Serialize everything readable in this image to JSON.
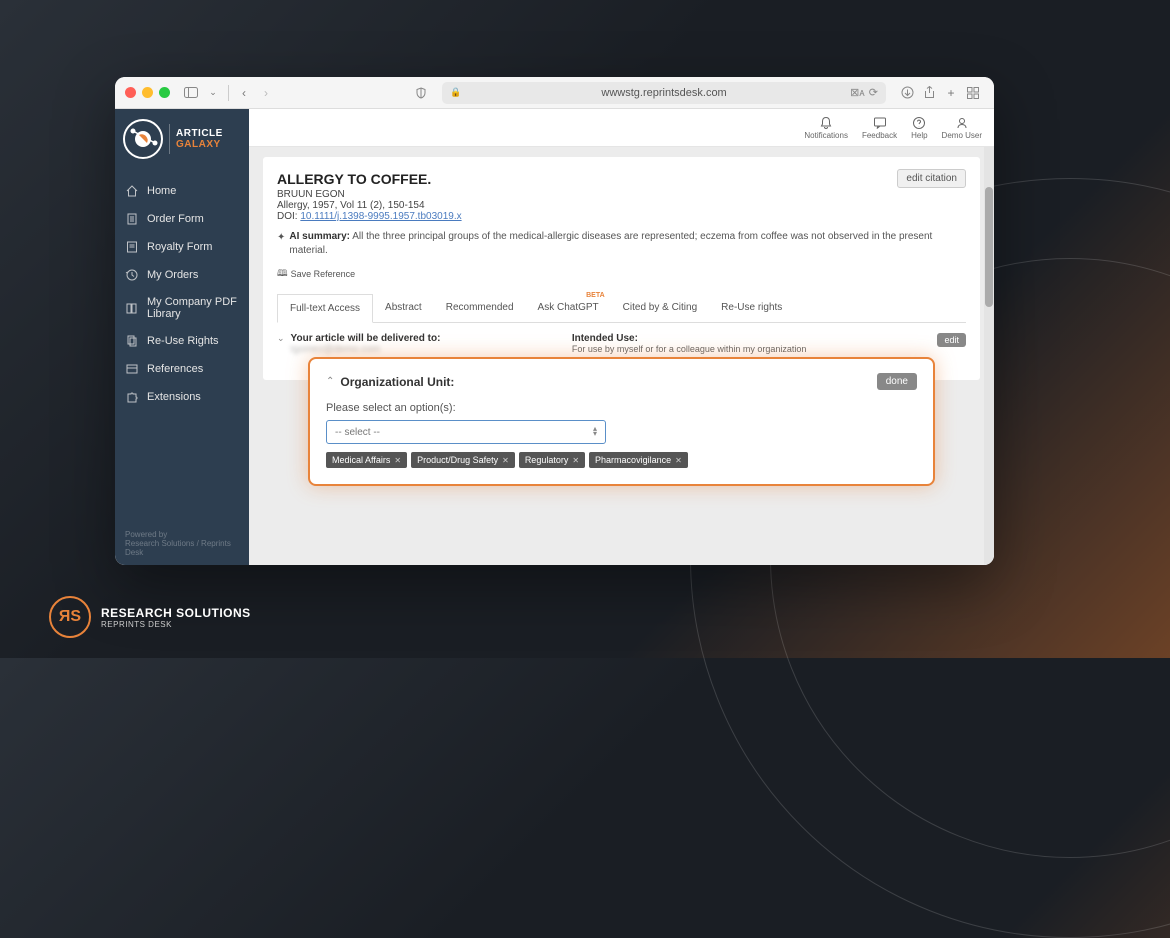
{
  "browser": {
    "url": "wwwstg.reprintsdesk.com"
  },
  "brand": {
    "name": "ARTICLE",
    "sub": "GALAXY"
  },
  "sidebar": {
    "items": [
      {
        "label": "Home",
        "icon": "home"
      },
      {
        "label": "Order Form",
        "icon": "file"
      },
      {
        "label": "Royalty Form",
        "icon": "doc"
      },
      {
        "label": "My Orders",
        "icon": "clock"
      },
      {
        "label": "My Company PDF Library",
        "icon": "library"
      },
      {
        "label": "Re-Use Rights",
        "icon": "copy"
      },
      {
        "label": "References",
        "icon": "refs"
      },
      {
        "label": "Extensions",
        "icon": "puzzle"
      }
    ],
    "powered": "Powered by",
    "powered_sub": "Research Solutions / Reprints Desk"
  },
  "topbar": {
    "notifications": "Notifications",
    "feedback": "Feedback",
    "help": "Help",
    "user": "Demo User"
  },
  "article": {
    "title": "ALLERGY TO COFFEE.",
    "author": "BRUUN EGON",
    "meta": "Allergy, 1957, Vol 11 (2), 150-154",
    "doi_label": "DOI: ",
    "doi": "10.1111/j.1398-9995.1957.tb03019.x",
    "edit_citation": "edit citation",
    "ai_label": "AI summary:",
    "ai_text": "All the three principal groups of the medical-allergic diseases are represented; eczema from coffee was not observed in the present material.",
    "save_ref": "Save Reference"
  },
  "tabs": [
    {
      "label": "Full-text Access",
      "active": true
    },
    {
      "label": "Abstract"
    },
    {
      "label": "Recommended"
    },
    {
      "label": "Ask ChatGPT",
      "beta": "BETA"
    },
    {
      "label": "Cited by & Citing"
    },
    {
      "label": "Re-Use rights"
    }
  ],
  "delivery": {
    "label": "Your article will be delivered to:",
    "email": "tgomez@demo.com",
    "intended_label": "Intended Use:",
    "intended_text": "For use by myself or for a colleague within my organization",
    "edit": "edit"
  },
  "org": {
    "title": "Organizational Unit:",
    "done": "done",
    "prompt": "Please select an option(s):",
    "select_placeholder": "-- select --",
    "tags": [
      "Medical Affairs",
      "Product/Drug Safety",
      "Regulatory",
      "Pharmacovigilance"
    ]
  },
  "footer": {
    "logo": "ЯS",
    "name": "RESEARCH SOLUTIONS",
    "sub": "REPRINTS DESK"
  }
}
